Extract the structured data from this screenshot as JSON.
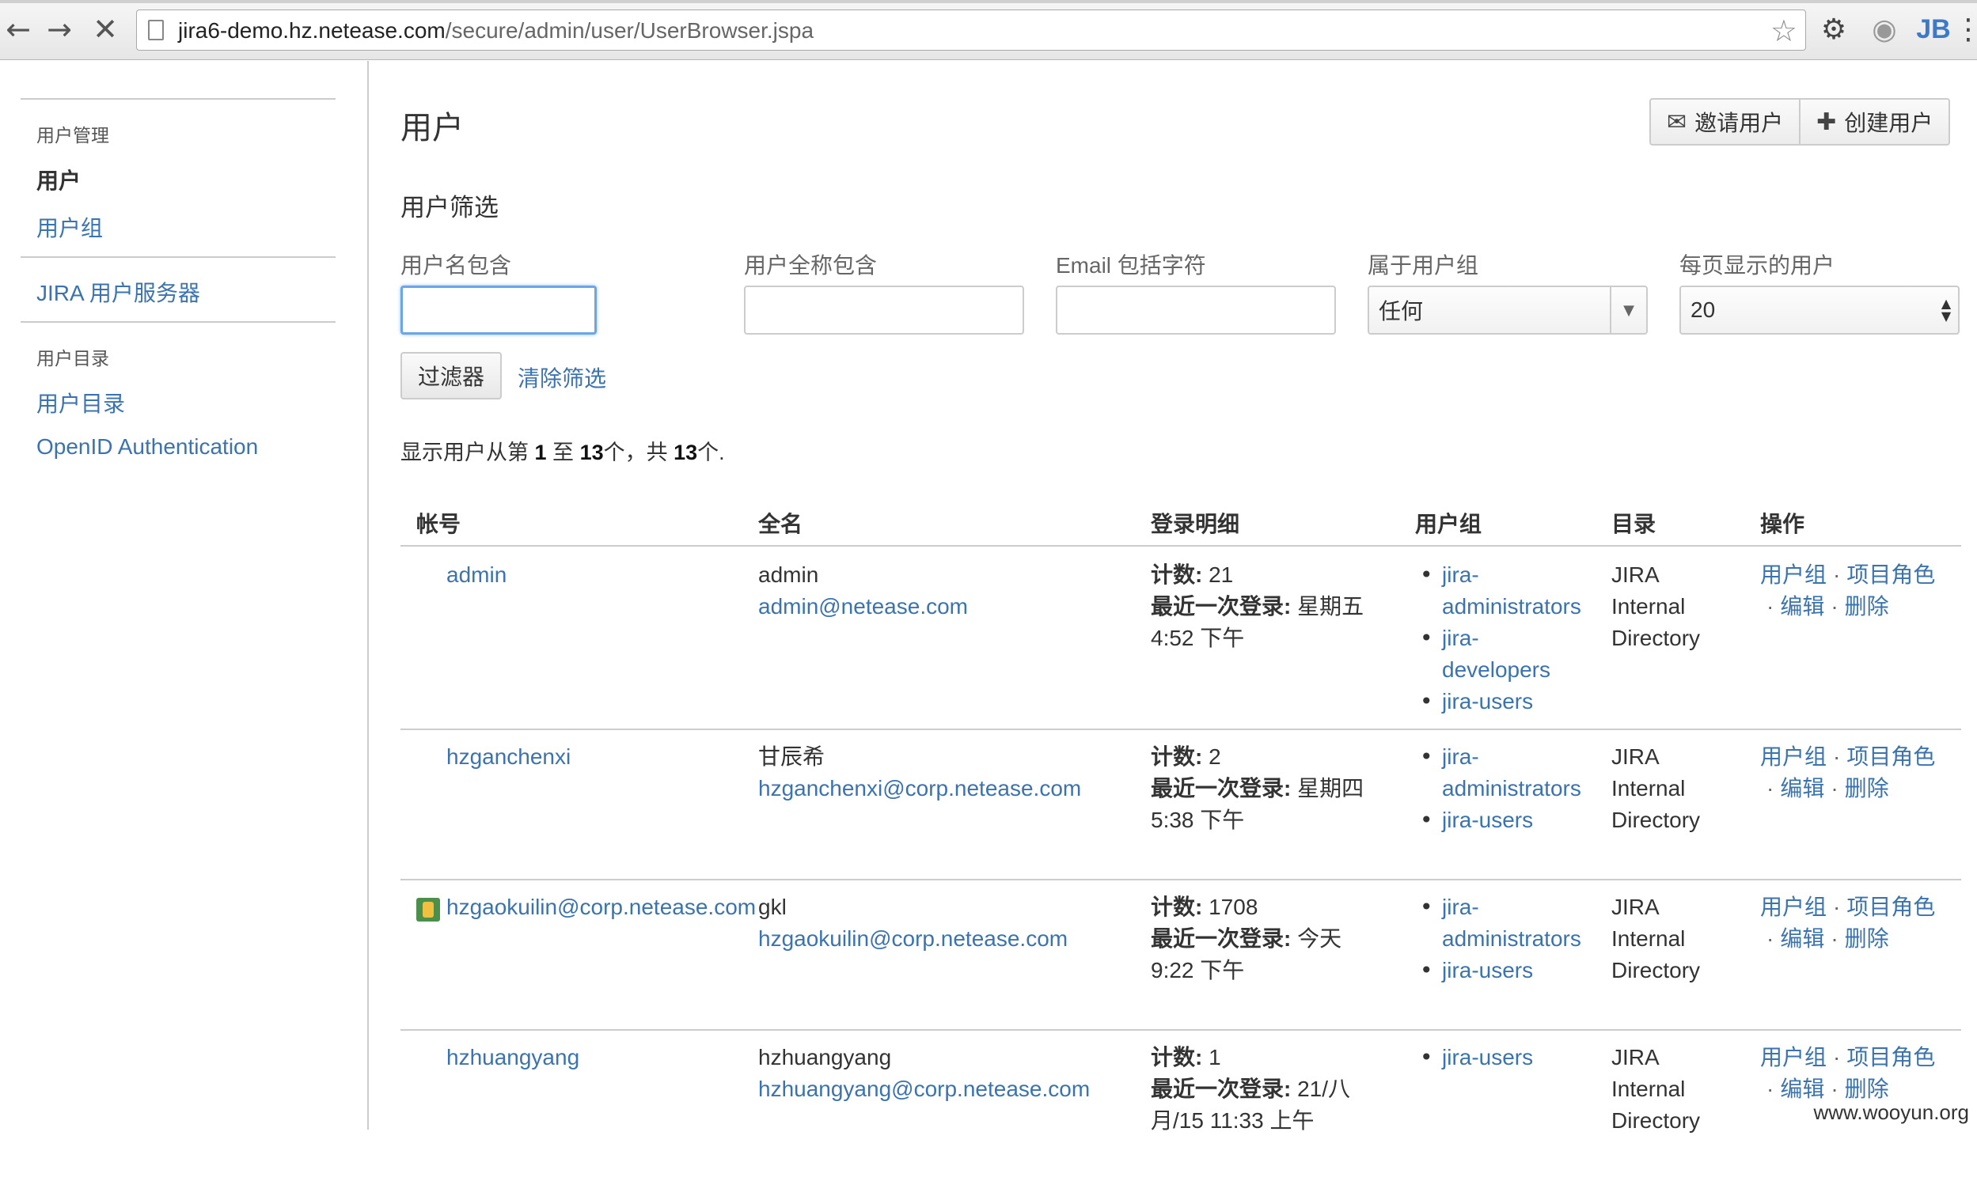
{
  "browser": {
    "url_host": "jira6-demo.hz.netease.com",
    "url_path": "/secure/admin/user/UserBrowser.jspa",
    "back_icon": "arrow-left-icon",
    "forward_icon": "arrow-right-icon",
    "stop_icon": "close-icon",
    "ext_jb": "JB"
  },
  "sidebar": {
    "section1_heading": "用户管理",
    "users_active": "用户",
    "groups_link": "用户组",
    "jira_user_server": "JIRA 用户服务器",
    "section2_heading": "用户目录",
    "user_directories": "用户目录",
    "openid": "OpenID Authentication"
  },
  "main": {
    "title": "用户",
    "invite_button": "邀请用户",
    "create_button": "创建用户",
    "filter_section": "用户筛选",
    "filters": {
      "username_label": "用户名包含",
      "username_value": "",
      "fullname_label": "用户全称包含",
      "fullname_value": "",
      "email_label": "Email 包括字符",
      "email_value": "",
      "group_label": "属于用户组",
      "group_value": "任何",
      "perpage_label": "每页显示的用户",
      "perpage_value": "20",
      "filter_button": "过滤器",
      "clear_link": "清除筛选"
    },
    "summary": {
      "prefix": "显示用户从第 ",
      "from": "1",
      "mid": " 至 ",
      "to": "13",
      "mid2": "个，共 ",
      "total": "13",
      "suffix": "个."
    },
    "table": {
      "headers": [
        "帐号",
        "全名",
        "登录明细",
        "用户组",
        "目录",
        "操作"
      ],
      "count_label": "计数:",
      "last_login_label": "最近一次登录:",
      "op_groups": "用户组",
      "op_roles": "项目角色",
      "op_edit": "编辑",
      "op_delete": "删除",
      "rows": [
        {
          "account": "admin",
          "fullname": "admin",
          "email": "admin@netease.com",
          "count": "21",
          "last_login_1": "星期五",
          "last_login_2": "4:52 下午",
          "groups": [
            "jira-",
            "administrators",
            "jira-",
            "developers",
            "jira-users"
          ],
          "dir": [
            "JIRA",
            "Internal",
            "Directory"
          ]
        },
        {
          "account": "hzganchenxi",
          "fullname": "甘辰希",
          "email": "hzganchenxi@corp.netease.com",
          "count": "2",
          "last_login_1": "星期四",
          "last_login_2": "5:38 下午",
          "groups": [
            "jira-",
            "administrators",
            "jira-users"
          ],
          "dir": [
            "JIRA",
            "Internal",
            "Directory"
          ]
        },
        {
          "account": "hzgaokuilin@corp.netease.com",
          "fullname": "gkl",
          "email": "hzgaokuilin@corp.netease.com",
          "count": "1708",
          "last_login_1": "今天",
          "last_login_2": "9:22 下午",
          "groups": [
            "jira-",
            "administrators",
            "jira-users"
          ],
          "dir": [
            "JIRA",
            "Internal",
            "Directory"
          ]
        },
        {
          "account": "hzhuangyang",
          "fullname": "hzhuangyang",
          "email": "hzhuangyang@corp.netease.com",
          "count": "1",
          "last_login_1": "21/八",
          "last_login_2": "月/15 11:33 上午",
          "groups": [
            "jira-users"
          ],
          "dir": [
            "JIRA",
            "Internal",
            "Directory"
          ]
        }
      ]
    }
  },
  "watermark": "www.wooyun.org"
}
